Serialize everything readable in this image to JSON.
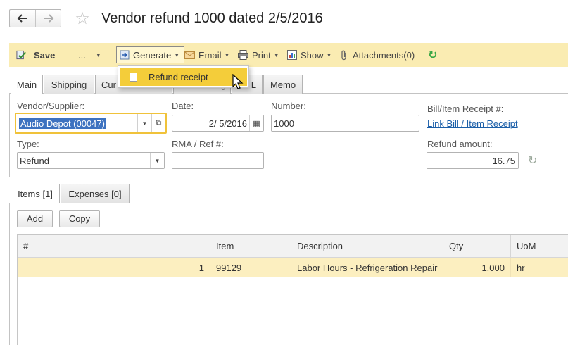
{
  "title": "Vendor refund 1000 dated 2/5/2016",
  "toolbar": {
    "save": "Save",
    "more": "...",
    "generate": "Generate",
    "email": "Email",
    "print": "Print",
    "show": "Show",
    "attachments": "Attachments(0)"
  },
  "generate_menu": {
    "items": [
      "Refund receipt"
    ]
  },
  "tabs": [
    "Main",
    "Shipping",
    "Cur",
    "g",
    "L",
    "Memo"
  ],
  "form": {
    "vendor_label": "Vendor/Supplier:",
    "vendor_value": "Audio Depot (00047)",
    "date_label": "Date:",
    "date_value": "2/ 5/2016",
    "number_label": "Number:",
    "number_value": "1000",
    "bill_label": "Bill/Item Receipt #:",
    "bill_link": "Link Bill / Item Receipt",
    "type_label": "Type:",
    "type_value": "Refund",
    "rma_label": "RMA / Ref #:",
    "rma_value": "",
    "amount_label": "Refund amount:",
    "amount_value": "16.75"
  },
  "subtabs": [
    "Items [1]",
    "Expenses [0]"
  ],
  "buttons": {
    "add": "Add",
    "copy": "Copy"
  },
  "table": {
    "columns": [
      "#",
      "Item",
      "Description",
      "Qty",
      "UoM"
    ],
    "rows": [
      {
        "num": "1",
        "item": "99129",
        "description": "Labor Hours - Refrigeration Repair",
        "qty": "1.000",
        "uom": "hr"
      }
    ]
  },
  "colors": {
    "toolbar": "#faecb2",
    "highlight": "#f4cd3a",
    "focus": "#f0c23a",
    "row_selected": "#fcefc0",
    "link": "#1a5ea8"
  }
}
